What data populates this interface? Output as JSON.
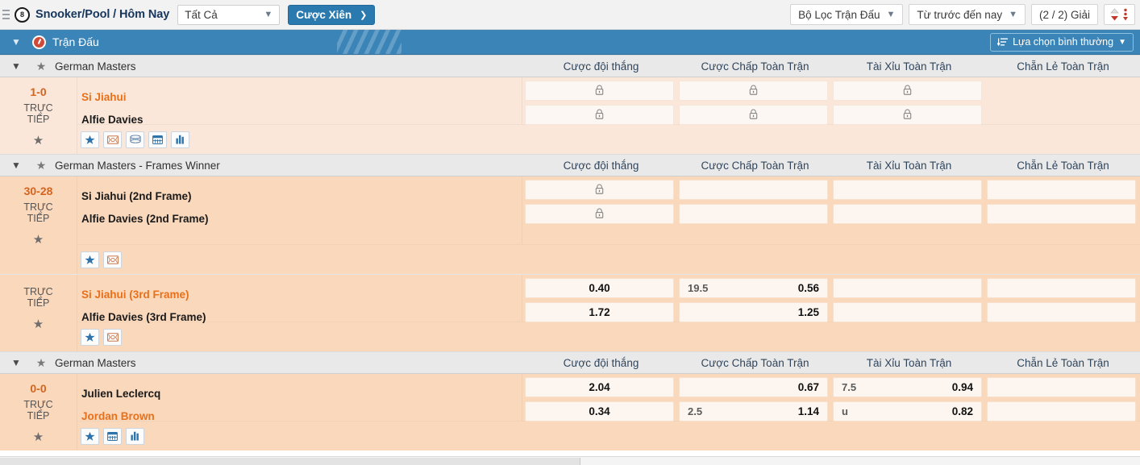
{
  "topbar": {
    "sport_icon": "snooker-ball-icon",
    "breadcrumb": "Snooker/Pool / Hôm Nay",
    "all_select": "Tất Cả",
    "parlay_button": "Cược Xiên",
    "match_filter": "Bộ Lọc Trận Đấu",
    "time_filter": "Từ trước đến nay",
    "league_count": "(2 / 2) Giải",
    "sort_icon": "sort-toggle-icon"
  },
  "bluebar": {
    "title": "Trận Đấu",
    "clock_icon": "live-clock-icon",
    "normal_option": "Lựa chọn bình thường",
    "sort_icon": "sort-lines-icon"
  },
  "columns": [
    "Cược đội thắng",
    "Cược Chấp Toàn Trận",
    "Tài Xỉu Toàn Trận",
    "Chẵn Lẻ Toàn Trận"
  ],
  "sections": [
    {
      "league": "German Masters",
      "shade": "lite",
      "matches": [
        {
          "score": "1-0",
          "live_label_1": "TRỰC",
          "live_label_2": "TIẾP",
          "show_score": true,
          "teams": [
            {
              "name": "Si Jiahui",
              "highlight": true
            },
            {
              "name": "Alfie Davies",
              "highlight": false
            }
          ],
          "markets": [
            {
              "rows": [
                {
                  "hdp": "",
                  "odd": "",
                  "locked": true
                },
                {
                  "hdp": "",
                  "odd": "",
                  "locked": true
                }
              ]
            },
            {
              "rows": [
                {
                  "hdp": "",
                  "odd": "",
                  "locked": true
                },
                {
                  "hdp": "",
                  "odd": "",
                  "locked": true
                }
              ]
            },
            {
              "rows": [
                {
                  "hdp": "",
                  "odd": "",
                  "locked": true
                },
                {
                  "hdp": "",
                  "odd": "",
                  "locked": true
                }
              ]
            },
            {
              "rows": [
                {
                  "empty": true
                },
                {
                  "empty": true
                }
              ]
            }
          ],
          "actions": [
            "star-icon",
            "tv-icon",
            "stack-icon",
            "calendar-icon",
            "stats-icon"
          ]
        }
      ]
    },
    {
      "league": "German Masters - Frames Winner",
      "shade": "dark",
      "matches": [
        {
          "score": "30-28",
          "live_label_1": "TRỰC",
          "live_label_2": "TIẾP",
          "show_score": true,
          "tall": true,
          "teams": [
            {
              "name": "Si Jiahui (2nd Frame)",
              "highlight": false
            },
            {
              "name": "Alfie Davies (2nd Frame)",
              "highlight": false
            }
          ],
          "markets": [
            {
              "rows": [
                {
                  "hdp": "",
                  "odd": "",
                  "locked": true
                },
                {
                  "hdp": "",
                  "odd": "",
                  "locked": true
                }
              ]
            },
            {
              "rows": [
                {
                  "empty": true
                },
                {
                  "empty": true
                }
              ]
            },
            {
              "rows": [
                {
                  "empty": true
                },
                {
                  "empty": true
                }
              ]
            },
            {
              "rows": [
                {
                  "empty": true
                },
                {
                  "empty": true
                }
              ]
            }
          ],
          "actions": [
            "star-icon",
            "tv-icon"
          ]
        },
        {
          "score": "",
          "live_label_1": "TRỰC",
          "live_label_2": "TIẾP",
          "show_score": false,
          "teams": [
            {
              "name": "Si Jiahui (3rd Frame)",
              "highlight": true
            },
            {
              "name": "Alfie Davies (3rd Frame)",
              "highlight": false
            }
          ],
          "markets": [
            {
              "rows": [
                {
                  "hdp": "",
                  "odd": "0.40",
                  "center": true
                },
                {
                  "hdp": "",
                  "odd": "1.72",
                  "center": true
                }
              ]
            },
            {
              "rows": [
                {
                  "hdp": "19.5",
                  "odd": "0.56"
                },
                {
                  "hdp": "",
                  "odd": "1.25"
                }
              ]
            },
            {
              "rows": [
                {
                  "empty": true
                },
                {
                  "empty": true
                }
              ]
            },
            {
              "rows": [
                {
                  "empty": true
                },
                {
                  "empty": true
                }
              ]
            }
          ],
          "actions": [
            "star-icon",
            "tv-icon"
          ]
        }
      ]
    },
    {
      "league": "German Masters",
      "shade": "dark",
      "matches": [
        {
          "score": "0-0",
          "live_label_1": "TRỰC",
          "live_label_2": "TIẾP",
          "show_score": true,
          "teams": [
            {
              "name": "Julien Leclercq",
              "highlight": false
            },
            {
              "name": "Jordan Brown",
              "highlight": true
            }
          ],
          "markets": [
            {
              "rows": [
                {
                  "hdp": "",
                  "odd": "2.04",
                  "center": true
                },
                {
                  "hdp": "",
                  "odd": "0.34",
                  "center": true
                }
              ]
            },
            {
              "rows": [
                {
                  "hdp": "",
                  "odd": "0.67"
                },
                {
                  "hdp": "2.5",
                  "odd": "1.14"
                }
              ]
            },
            {
              "rows": [
                {
                  "hdp": "7.5",
                  "odd": "0.94"
                },
                {
                  "hdp": "u",
                  "odd": "0.82"
                }
              ]
            },
            {
              "rows": [
                {
                  "empty": true
                },
                {
                  "empty": true
                }
              ]
            }
          ],
          "actions": [
            "star-icon",
            "calendar-icon",
            "stats-icon"
          ]
        }
      ]
    }
  ]
}
